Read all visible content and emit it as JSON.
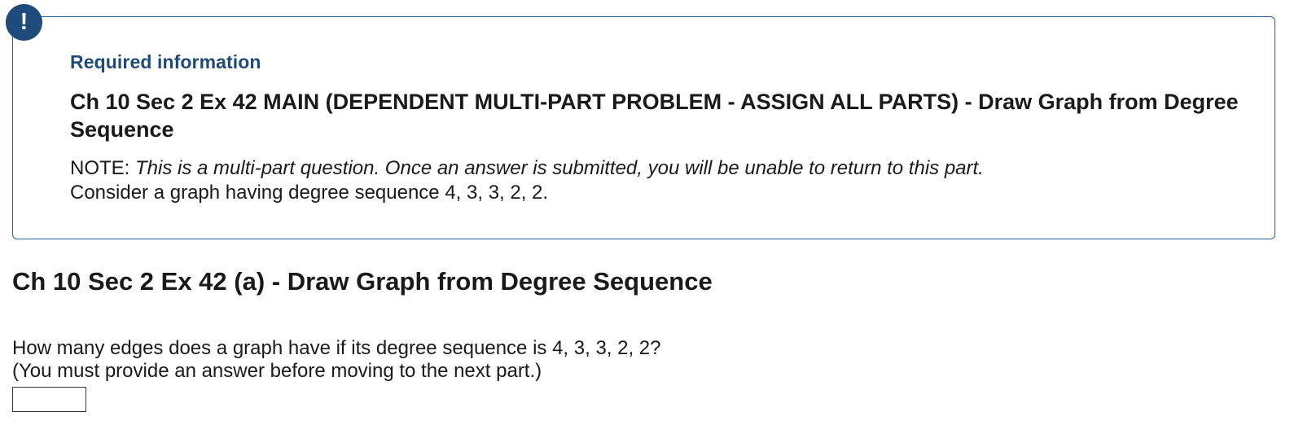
{
  "alert": {
    "icon": "exclamation-icon",
    "symbol": "!"
  },
  "info": {
    "label": "Required information",
    "title": "Ch 10 Sec 2 Ex 42 MAIN (DEPENDENT MULTI-PART PROBLEM - ASSIGN ALL PARTS) - Draw Graph from Degree Sequence",
    "note_prefix": "NOTE:",
    "note_body": "This is a multi-part question. Once an answer is submitted, you will be unable to return to this part.",
    "consider": "Consider a graph having degree sequence 4, 3, 3, 2, 2."
  },
  "part": {
    "title": "Ch 10 Sec 2 Ex 42 (a) - Draw Graph from Degree Sequence",
    "question": "How many edges does a graph have if its degree sequence is 4, 3, 3, 2, 2?",
    "instruction": "(You must provide an answer before moving to the next part.)",
    "answer_value": ""
  },
  "colors": {
    "accent": "#1f4a7c",
    "border": "#2f5d91",
    "text": "#1a1a1a"
  }
}
